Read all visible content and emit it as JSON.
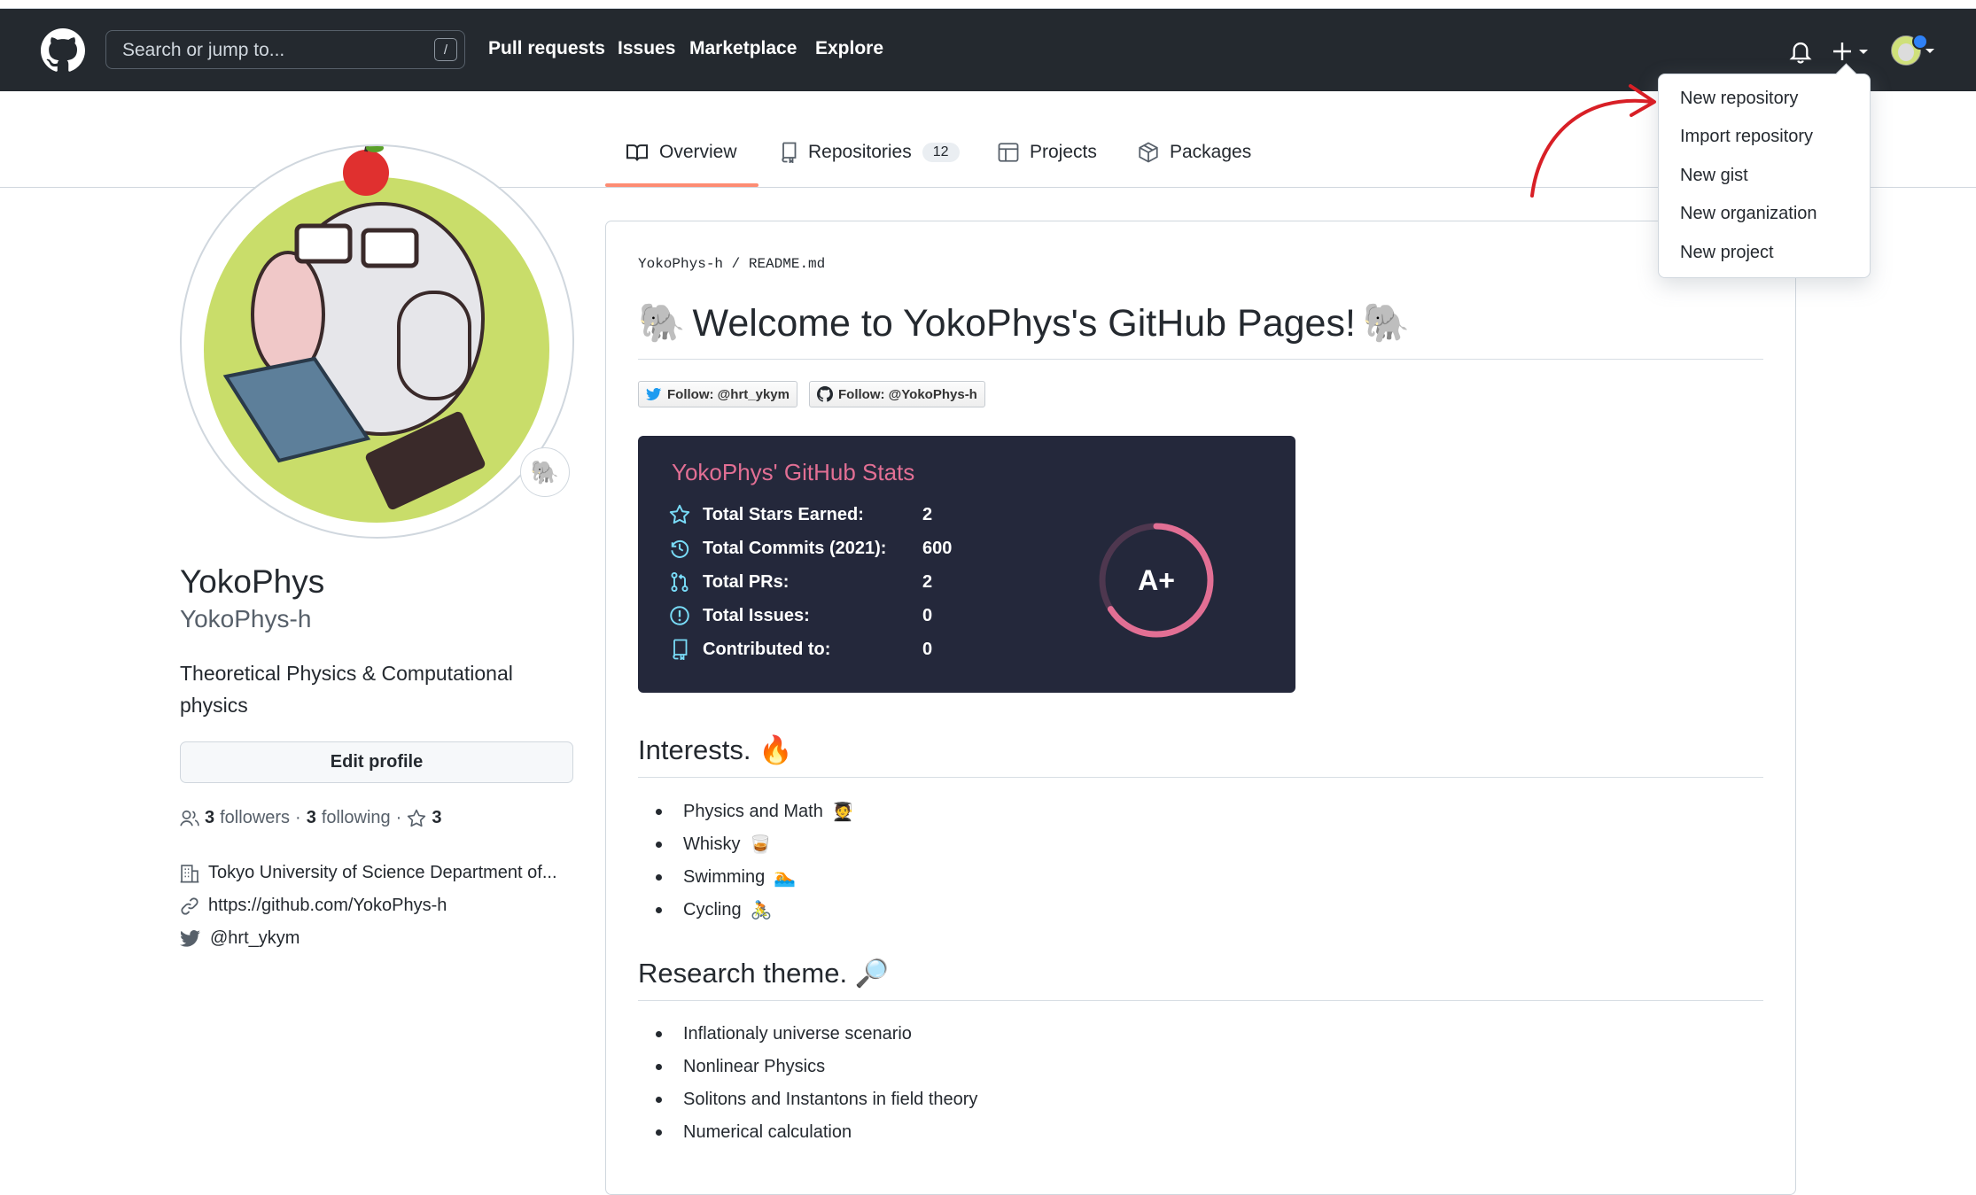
{
  "header": {
    "search_placeholder": "Search or jump to...",
    "search_shortcut": "/",
    "nav": [
      "Pull requests",
      "Issues",
      "Marketplace",
      "Explore"
    ]
  },
  "dropdown": {
    "items": [
      "New repository",
      "Import repository",
      "New gist",
      "New organization",
      "New project"
    ]
  },
  "tabs": {
    "overview": "Overview",
    "repositories": "Repositories",
    "repositories_count": "12",
    "projects": "Projects",
    "packages": "Packages"
  },
  "profile": {
    "name": "YokoPhys",
    "login": "YokoPhys-h",
    "bio": "Theoretical Physics & Computational physics",
    "edit_button": "Edit profile",
    "followers_count": "3",
    "followers_label": "followers",
    "following_count": "3",
    "following_label": "following",
    "stars_count": "3",
    "organization": "Tokyo University of Science Department of...",
    "website": "https://github.com/YokoPhys-h",
    "twitter": "@hrt_ykym",
    "status_emoji": "🐘"
  },
  "readme": {
    "crumb_user": "YokoPhys-h",
    "crumb_sep": "/",
    "crumb_file": "README.md",
    "title_emoji": "🐘",
    "title": "Welcome to YokoPhys's GitHub Pages!",
    "badges": [
      {
        "label": "Follow: @hrt_ykym",
        "icon": "twitter-icon"
      },
      {
        "label": "Follow: @YokoPhys-h",
        "icon": "github-icon"
      }
    ],
    "stats": {
      "title": "YokoPhys' GitHub Stats",
      "rows": [
        {
          "label": "Total Stars Earned:",
          "value": "2",
          "icon": "star-icon"
        },
        {
          "label": "Total Commits (2021):",
          "value": "600",
          "icon": "history-icon"
        },
        {
          "label": "Total PRs:",
          "value": "2",
          "icon": "pull-request-icon"
        },
        {
          "label": "Total Issues:",
          "value": "0",
          "icon": "issue-icon"
        },
        {
          "label": "Contributed to:",
          "value": "0",
          "icon": "repo-icon"
        }
      ],
      "rank": "A+",
      "rank_progress": 0.66,
      "colors": {
        "background": "#24283b",
        "title": "#e26f94",
        "icon": "#79dcf8",
        "ring": "#e26f94"
      }
    },
    "interests_title": "Interests.",
    "interests_emoji": "🔥",
    "interests": [
      {
        "text": "Physics and Math",
        "emoji": "🧑‍🎓"
      },
      {
        "text": "Whisky",
        "emoji": "🥃"
      },
      {
        "text": "Swimming",
        "emoji": "🏊"
      },
      {
        "text": "Cycling",
        "emoji": "🚴"
      }
    ],
    "research_title": "Research theme.",
    "research_emoji": "🔎",
    "research": [
      "Inflationaly universe scenario",
      "Nonlinear Physics",
      "Solitons and Instantons in field theory",
      "Numerical calculation"
    ]
  }
}
